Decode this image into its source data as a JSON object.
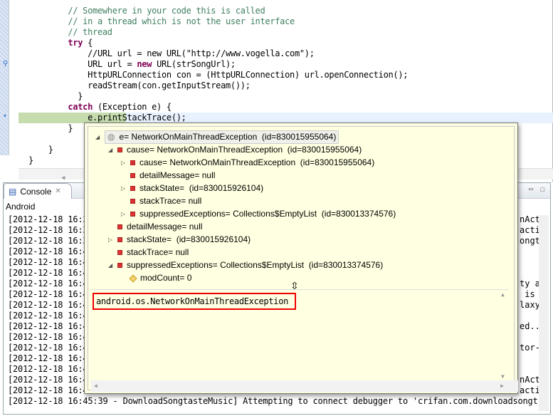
{
  "editor": {
    "lines": [
      {
        "indent": "        ",
        "segs": [
          [
            "cmt",
            "// Somewhere in your code this is called"
          ]
        ]
      },
      {
        "indent": "        ",
        "segs": [
          [
            "cmt",
            "// in a thread which is not the user interface"
          ]
        ]
      },
      {
        "indent": "        ",
        "segs": [
          [
            "cmt",
            "// thread"
          ]
        ]
      },
      {
        "indent": "        ",
        "segs": [
          [
            "kw",
            "try"
          ],
          [
            "",
            "{"
          ]
        ]
      },
      {
        "indent": "            ",
        "segs": [
          [
            "",
            "//URL url = new URL(\"http://www.vogella.com\");"
          ]
        ]
      },
      {
        "indent": "            ",
        "segs": [
          [
            "",
            "URL url = "
          ],
          [
            "kw",
            "new"
          ],
          [
            "",
            " URL(strSongUrl);"
          ]
        ]
      },
      {
        "indent": "            ",
        "segs": [
          [
            "",
            "HttpURLConnection con = (HttpURLConnection) url.openConnection();"
          ]
        ]
      },
      {
        "indent": "            ",
        "segs": [
          [
            "",
            "readStream(con.getInputStream());"
          ]
        ]
      },
      {
        "indent": "          ",
        "segs": [
          [
            "",
            "}"
          ]
        ]
      },
      {
        "indent": "        ",
        "segs": [
          [
            "kw",
            "catch"
          ],
          [
            "",
            " (Exception e) {"
          ]
        ]
      },
      {
        "indent": "            ",
        "segs": [
          [
            "",
            "e.printStackTrace();"
          ]
        ]
      },
      {
        "indent": "        ",
        "segs": [
          [
            "",
            "}"
          ]
        ]
      },
      {
        "indent": "",
        "segs": []
      },
      {
        "indent": "    ",
        "segs": [
          [
            "",
            "}"
          ]
        ]
      },
      {
        "indent": "",
        "segs": [
          [
            "",
            "}"
          ]
        ]
      }
    ]
  },
  "console": {
    "tab_label": "Console",
    "device": "Android",
    "lines": [
      {
        "left": "[2012-12-18 16:3",
        "right": "nAct"
      },
      {
        "left": "[2012-12-18 16:3",
        "right": "acti"
      },
      {
        "left": "[2012-12-18 16:3",
        "right": "ongt"
      },
      {
        "left": "[2012-12-18 16:4",
        "right": ""
      },
      {
        "left": "[2012-12-18 16:4",
        "right": ""
      },
      {
        "left": "[2012-12-18 16:4",
        "right": ""
      },
      {
        "left": "[2012-12-18 16:4",
        "right": "ty a"
      },
      {
        "left": "[2012-12-18 16:4",
        "right": " is"
      },
      {
        "left": "[2012-12-18 16:4",
        "right": "laxy"
      },
      {
        "left": "[2012-12-18 16:4",
        "right": ""
      },
      {
        "left": "[2012-12-18 16:4",
        "right": "ed.."
      },
      {
        "left": "[2012-12-18 16:4",
        "right": ""
      },
      {
        "left": "[2012-12-18 16:4",
        "right": "tor-"
      },
      {
        "left": "[2012-12-18 16:4",
        "right": ""
      },
      {
        "left": "[2012-12-18 16:4",
        "right": ""
      },
      {
        "left": "[2012-12-18 16:4",
        "right": "nAct"
      },
      {
        "left": "[2012-12-18 16:4",
        "right": "acti"
      },
      {
        "left": "[2012-12-18 16:45:39 - DownloadSongtasteMusic] Attempting to connect debugger to 'crifan.com.downloadsongt",
        "right": ""
      }
    ]
  },
  "popup": {
    "tree": [
      {
        "level": 0,
        "toggle": "expanded",
        "icon": "local-variable-icon",
        "text": "e= NetworkOnMainThreadException  (id=830015955064)",
        "selected": true
      },
      {
        "level": 1,
        "toggle": "expanded",
        "icon": "field-icon",
        "text": "cause= NetworkOnMainThreadException  (id=830015955064)"
      },
      {
        "level": 2,
        "toggle": "collapsed",
        "icon": "field-icon",
        "text": "cause= NetworkOnMainThreadException  (id=830015955064)"
      },
      {
        "level": 2,
        "toggle": "",
        "icon": "field-icon",
        "text": "detailMessage= null"
      },
      {
        "level": 2,
        "toggle": "collapsed",
        "icon": "field-icon",
        "text": "stackState=  (id=830015926104)"
      },
      {
        "level": 2,
        "toggle": "",
        "icon": "field-icon",
        "text": "stackTrace= null"
      },
      {
        "level": 2,
        "toggle": "collapsed",
        "icon": "field-icon",
        "text": "suppressedExceptions= Collections$EmptyList  (id=830013374576)"
      },
      {
        "level": 1,
        "toggle": "",
        "icon": "field-icon",
        "text": "detailMessage= null"
      },
      {
        "level": 1,
        "toggle": "collapsed",
        "icon": "field-icon",
        "text": "stackState=  (id=830015926104)"
      },
      {
        "level": 1,
        "toggle": "",
        "icon": "field-icon",
        "text": "stackTrace= null"
      },
      {
        "level": 1,
        "toggle": "expanded",
        "icon": "field-icon",
        "text": "suppressedExceptions= Collections$EmptyList  (id=830013374576)"
      },
      {
        "level": 2,
        "toggle": "",
        "icon": "protected-field-icon",
        "text": "modCount= 0"
      }
    ],
    "detail_text": "android.os.NetworkOnMainThreadException"
  },
  "colors": {
    "highlight": "#e00000",
    "current_line": "#c6dbae",
    "comment": "#3f7f5f",
    "keyword": "#7f0055"
  }
}
